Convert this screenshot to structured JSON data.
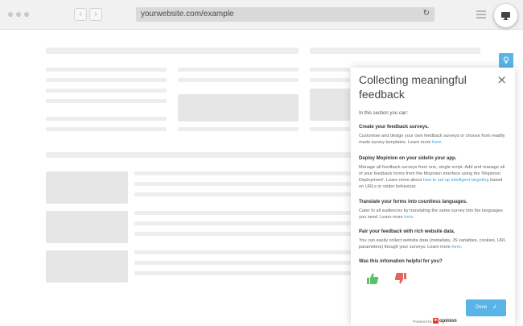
{
  "browser": {
    "url": "yourwebsite.com/example",
    "back_icon": "chevron-left-icon",
    "forward_icon": "chevron-right-icon",
    "reload_icon": "reload-icon",
    "back_glyph": "‹",
    "forward_glyph": "›",
    "reload_glyph": "↻"
  },
  "panel": {
    "title": "Collecting meaningful feedback",
    "close_glyph": "×",
    "intro": "In this section you can:",
    "sections": [
      {
        "heading": "Create your feedback surveys.",
        "text": "Customise and design your own feedback surveys or choose from readily made survey templates. Learn more ",
        "link": "here",
        "after": "."
      },
      {
        "heading": "Deploy Mopinion on your side/in your app.",
        "text": "Manage all feedback surveys from one, single script. Add and manage all of your feedback forms from the Mopinion interface using the 'Mopinion Deployment'. Learn more about ",
        "link": "how to set up intelligent targeting",
        "after": " based on URLs or visitor behaviour."
      },
      {
        "heading": "Translate your forms into countless languages.",
        "text": "Cater to all audiences by translating the same survey into the languages you need. Learn more ",
        "link": "here",
        "after": "."
      },
      {
        "heading": "Pair your feedback with rich website data.",
        "text": "You can easily collect website data (metadata, JS variables, cookies, URL parameters) though your surveys. Learn more ",
        "link": "here",
        "after": "."
      }
    ],
    "question": "Was this infomation helpful for you?",
    "done_label": "Done",
    "done_icon": "enter-arrow-icon",
    "done_glyph": "↲",
    "powered_by": "Powered by",
    "logo_text": "opinion",
    "logo_letter": "m"
  },
  "colors": {
    "accent": "#59b5e8",
    "link": "#3aa4e0",
    "thumb_up": "#5cc06a",
    "thumb_down": "#e2645a",
    "logo": "#e2342b"
  }
}
